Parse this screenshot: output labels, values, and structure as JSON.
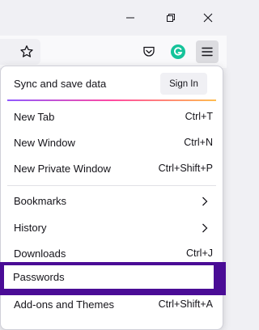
{
  "window": {
    "controls": [
      "minimize-icon",
      "restore-icon",
      "close-icon"
    ]
  },
  "toolbar": {
    "icons": [
      "bookmark-star-icon",
      "pocket-icon",
      "grammarly-icon",
      "app-menu-icon"
    ]
  },
  "menu": {
    "sync_label": "Sync and save data",
    "sign_in_label": "Sign In",
    "items": [
      {
        "label": "New Tab",
        "shortcut": "Ctrl+T"
      },
      {
        "label": "New Window",
        "shortcut": "Ctrl+N"
      },
      {
        "label": "New Private Window",
        "shortcut": "Ctrl+Shift+P"
      },
      {
        "label": "Bookmarks",
        "shortcut": ""
      },
      {
        "label": "History",
        "shortcut": ""
      },
      {
        "label": "Downloads",
        "shortcut": "Ctrl+J"
      },
      {
        "label": "Passwords",
        "shortcut": ""
      },
      {
        "label": "Add-ons and Themes",
        "shortcut": "Ctrl+Shift+A"
      }
    ]
  },
  "colors": {
    "highlight": "#4a0c96",
    "grammarly": "#15c39a"
  }
}
